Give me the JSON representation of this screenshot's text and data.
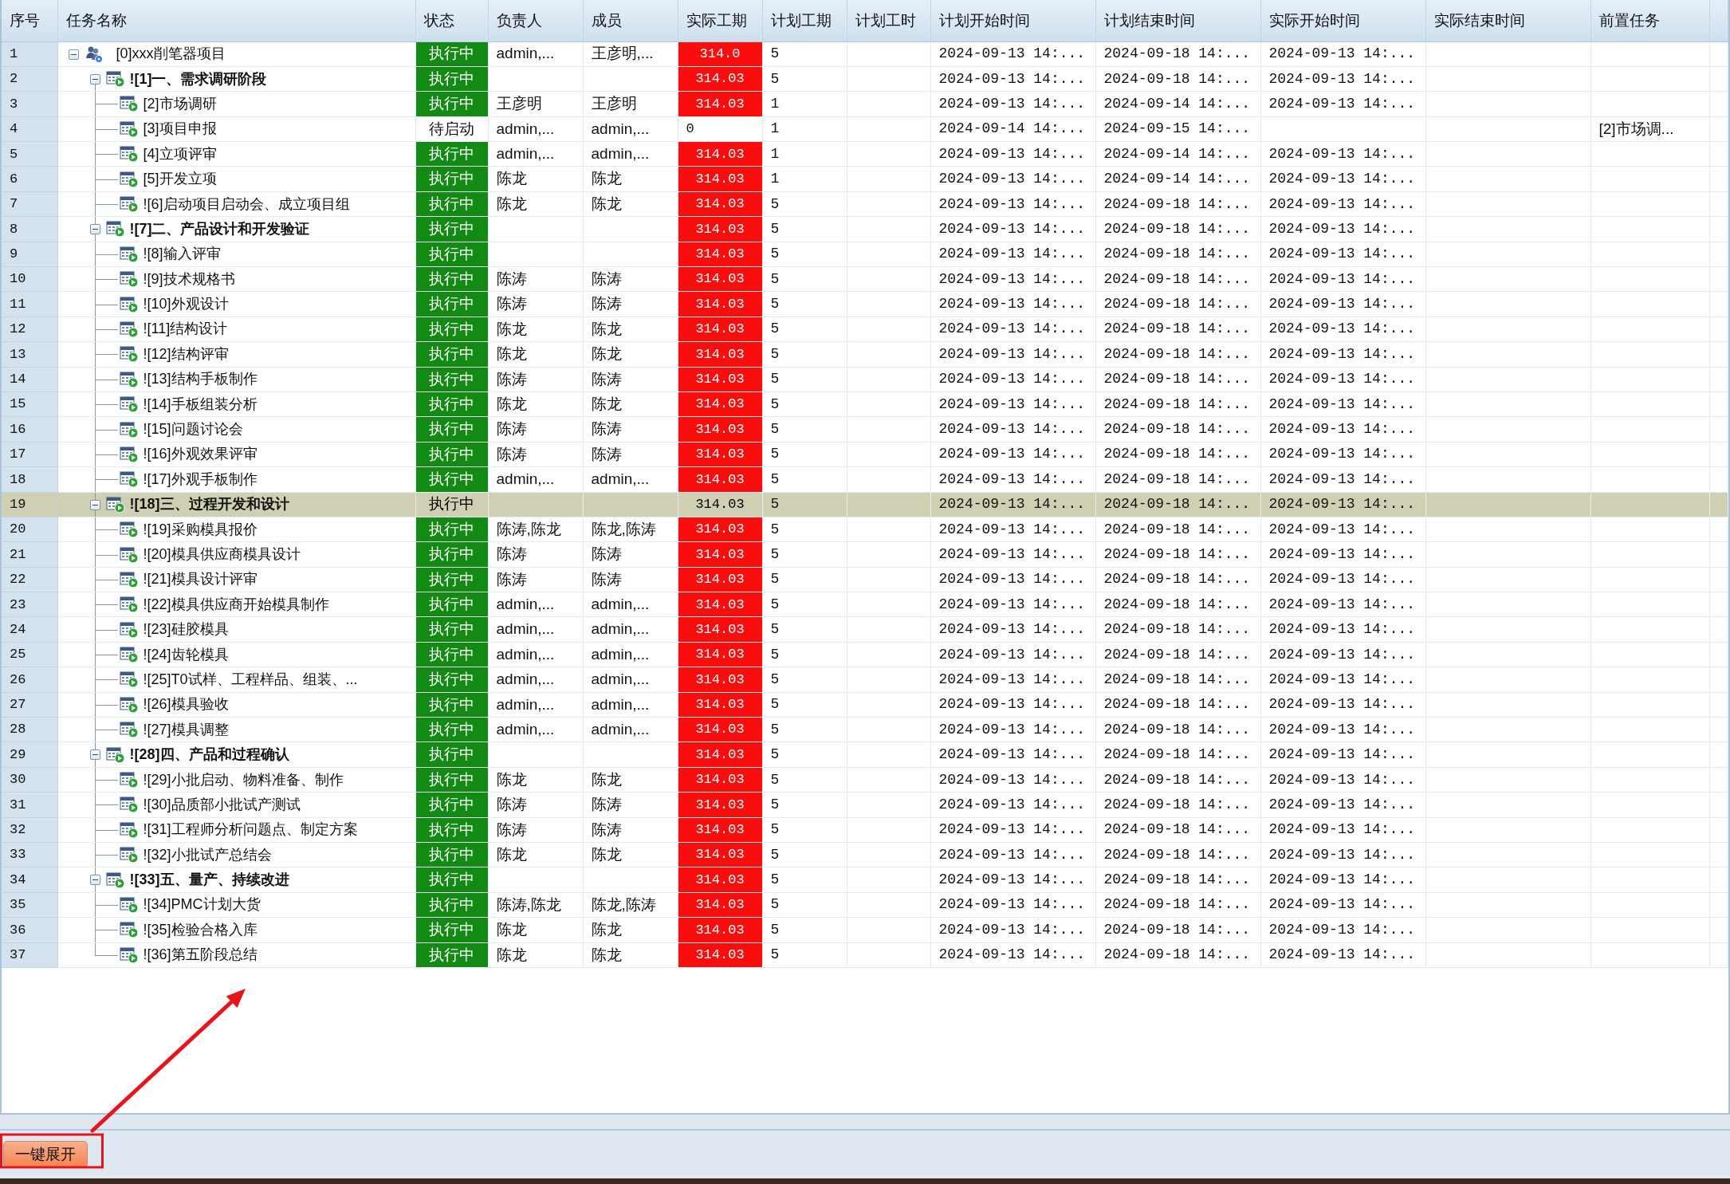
{
  "columns": [
    "序号",
    "任务名称",
    "状态",
    "负责人",
    "成员",
    "实际工期",
    "计划工期",
    "计划工时",
    "计划开始时间",
    "计划结束时间",
    "实际开始时间",
    "实际结束时间",
    "前置任务"
  ],
  "tasks": [
    {
      "seq": "1",
      "name": "[0]xxx削笔器项目",
      "kind": "project",
      "expanded": true,
      "selected": false,
      "status": {
        "text": "执行中",
        "kind": "running"
      },
      "owner": "admin,...",
      "members": "王彦明,...",
      "actual_days": "314.0",
      "overdue": true,
      "plan_days": "5",
      "plan_start": "2024-09-13 14:...",
      "plan_end": "2024-09-18 14:...",
      "actual_start": "2024-09-13 14:...",
      "children": [
        {
          "seq": "2",
          "name": "![1]一、需求调研阶段",
          "kind": "phase",
          "expanded": true,
          "selected": false,
          "status": {
            "text": "执行中",
            "kind": "running"
          },
          "actual_days": "314.03",
          "overdue": true,
          "plan_days": "5",
          "plan_start": "2024-09-13 14:...",
          "plan_end": "2024-09-18 14:...",
          "actual_start": "2024-09-13 14:...",
          "children": [
            {
              "seq": "3",
              "name": "[2]市场调研",
              "kind": "task",
              "selected": false,
              "status": {
                "text": "执行中",
                "kind": "running"
              },
              "owner": "王彦明",
              "members": "王彦明",
              "actual_days": "314.03",
              "overdue": true,
              "plan_days": "1",
              "plan_start": "2024-09-13 14:...",
              "plan_end": "2024-09-14 14:...",
              "actual_start": "2024-09-13 14:..."
            },
            {
              "seq": "4",
              "name": "[3]项目申报",
              "kind": "task",
              "selected": false,
              "status": {
                "text": "待启动",
                "kind": "pending"
              },
              "owner": "admin,...",
              "members": "admin,...",
              "actual_days": "0",
              "overdue": false,
              "plan_days": "1",
              "plan_start": "2024-09-14 14:...",
              "plan_end": "2024-09-15 14:...",
              "predecessor": "[2]市场调..."
            },
            {
              "seq": "5",
              "name": "[4]立项评审",
              "kind": "task",
              "selected": false,
              "status": {
                "text": "执行中",
                "kind": "running"
              },
              "owner": "admin,...",
              "members": "admin,...",
              "actual_days": "314.03",
              "overdue": true,
              "plan_days": "1",
              "plan_start": "2024-09-13 14:...",
              "plan_end": "2024-09-14 14:...",
              "actual_start": "2024-09-13 14:..."
            },
            {
              "seq": "6",
              "name": "[5]开发立项",
              "kind": "task",
              "selected": false,
              "status": {
                "text": "执行中",
                "kind": "running"
              },
              "owner": "陈龙",
              "members": "陈龙",
              "actual_days": "314.03",
              "overdue": true,
              "plan_days": "1",
              "plan_start": "2024-09-13 14:...",
              "plan_end": "2024-09-14 14:...",
              "actual_start": "2024-09-13 14:..."
            },
            {
              "seq": "7",
              "name": "![6]启动项目启动会、成立项目组",
              "kind": "task",
              "selected": false,
              "status": {
                "text": "执行中",
                "kind": "running"
              },
              "owner": "陈龙",
              "members": "陈龙",
              "actual_days": "314.03",
              "overdue": true,
              "plan_days": "5",
              "plan_start": "2024-09-13 14:...",
              "plan_end": "2024-09-18 14:...",
              "actual_start": "2024-09-13 14:..."
            }
          ]
        },
        {
          "seq": "8",
          "name": "![7]二、产品设计和开发验证",
          "kind": "phase",
          "expanded": true,
          "selected": false,
          "status": {
            "text": "执行中",
            "kind": "running"
          },
          "actual_days": "314.03",
          "overdue": true,
          "plan_days": "5",
          "plan_start": "2024-09-13 14:...",
          "plan_end": "2024-09-18 14:...",
          "actual_start": "2024-09-13 14:...",
          "children": [
            {
              "seq": "9",
              "name": "![8]输入评审",
              "kind": "task",
              "selected": false,
              "status": {
                "text": "执行中",
                "kind": "running"
              },
              "actual_days": "314.03",
              "overdue": true,
              "plan_days": "5",
              "plan_start": "2024-09-13 14:...",
              "plan_end": "2024-09-18 14:...",
              "actual_start": "2024-09-13 14:..."
            },
            {
              "seq": "10",
              "name": "![9]技术规格书",
              "kind": "task",
              "selected": false,
              "status": {
                "text": "执行中",
                "kind": "running"
              },
              "owner": "陈涛",
              "members": "陈涛",
              "actual_days": "314.03",
              "overdue": true,
              "plan_days": "5",
              "plan_start": "2024-09-13 14:...",
              "plan_end": "2024-09-18 14:...",
              "actual_start": "2024-09-13 14:..."
            },
            {
              "seq": "11",
              "name": "![10]外观设计",
              "kind": "task",
              "selected": false,
              "status": {
                "text": "执行中",
                "kind": "running"
              },
              "owner": "陈涛",
              "members": "陈涛",
              "actual_days": "314.03",
              "overdue": true,
              "plan_days": "5",
              "plan_start": "2024-09-13 14:...",
              "plan_end": "2024-09-18 14:...",
              "actual_start": "2024-09-13 14:..."
            },
            {
              "seq": "12",
              "name": "![11]结构设计",
              "kind": "task",
              "selected": false,
              "status": {
                "text": "执行中",
                "kind": "running"
              },
              "owner": "陈龙",
              "members": "陈龙",
              "actual_days": "314.03",
              "overdue": true,
              "plan_days": "5",
              "plan_start": "2024-09-13 14:...",
              "plan_end": "2024-09-18 14:...",
              "actual_start": "2024-09-13 14:..."
            },
            {
              "seq": "13",
              "name": "![12]结构评审",
              "kind": "task",
              "selected": false,
              "status": {
                "text": "执行中",
                "kind": "running"
              },
              "owner": "陈龙",
              "members": "陈龙",
              "actual_days": "314.03",
              "overdue": true,
              "plan_days": "5",
              "plan_start": "2024-09-13 14:...",
              "plan_end": "2024-09-18 14:...",
              "actual_start": "2024-09-13 14:..."
            },
            {
              "seq": "14",
              "name": "![13]结构手板制作",
              "kind": "task",
              "selected": false,
              "status": {
                "text": "执行中",
                "kind": "running"
              },
              "owner": "陈涛",
              "members": "陈涛",
              "actual_days": "314.03",
              "overdue": true,
              "plan_days": "5",
              "plan_start": "2024-09-13 14:...",
              "plan_end": "2024-09-18 14:...",
              "actual_start": "2024-09-13 14:..."
            },
            {
              "seq": "15",
              "name": "![14]手板组装分析",
              "kind": "task",
              "selected": false,
              "status": {
                "text": "执行中",
                "kind": "running"
              },
              "owner": "陈龙",
              "members": "陈龙",
              "actual_days": "314.03",
              "overdue": true,
              "plan_days": "5",
              "plan_start": "2024-09-13 14:...",
              "plan_end": "2024-09-18 14:...",
              "actual_start": "2024-09-13 14:..."
            },
            {
              "seq": "16",
              "name": "![15]问题讨论会",
              "kind": "task",
              "selected": false,
              "status": {
                "text": "执行中",
                "kind": "running"
              },
              "owner": "陈涛",
              "members": "陈涛",
              "actual_days": "314.03",
              "overdue": true,
              "plan_days": "5",
              "plan_start": "2024-09-13 14:...",
              "plan_end": "2024-09-18 14:...",
              "actual_start": "2024-09-13 14:..."
            },
            {
              "seq": "17",
              "name": "![16]外观效果评审",
              "kind": "task",
              "selected": false,
              "status": {
                "text": "执行中",
                "kind": "running"
              },
              "owner": "陈涛",
              "members": "陈涛",
              "actual_days": "314.03",
              "overdue": true,
              "plan_days": "5",
              "plan_start": "2024-09-13 14:...",
              "plan_end": "2024-09-18 14:...",
              "actual_start": "2024-09-13 14:..."
            },
            {
              "seq": "18",
              "name": "![17]外观手板制作",
              "kind": "task",
              "selected": false,
              "status": {
                "text": "执行中",
                "kind": "running"
              },
              "owner": "admin,...",
              "members": "admin,...",
              "actual_days": "314.03",
              "overdue": true,
              "plan_days": "5",
              "plan_start": "2024-09-13 14:...",
              "plan_end": "2024-09-18 14:...",
              "actual_start": "2024-09-13 14:..."
            }
          ]
        },
        {
          "seq": "19",
          "name": "![18]三、过程开发和设计",
          "kind": "phase",
          "expanded": true,
          "selected": true,
          "status": {
            "text": "执行中",
            "kind": "running"
          },
          "actual_days": "314.03",
          "overdue": true,
          "plan_days": "5",
          "plan_start": "2024-09-13 14:...",
          "plan_end": "2024-09-18 14:...",
          "actual_start": "2024-09-13 14:...",
          "children": [
            {
              "seq": "20",
              "name": "![19]采购模具报价",
              "kind": "task",
              "selected": false,
              "status": {
                "text": "执行中",
                "kind": "running"
              },
              "owner": "陈涛,陈龙",
              "members": "陈龙,陈涛",
              "actual_days": "314.03",
              "overdue": true,
              "plan_days": "5",
              "plan_start": "2024-09-13 14:...",
              "plan_end": "2024-09-18 14:...",
              "actual_start": "2024-09-13 14:..."
            },
            {
              "seq": "21",
              "name": "![20]模具供应商模具设计",
              "kind": "task",
              "selected": false,
              "status": {
                "text": "执行中",
                "kind": "running"
              },
              "owner": "陈涛",
              "members": "陈涛",
              "actual_days": "314.03",
              "overdue": true,
              "plan_days": "5",
              "plan_start": "2024-09-13 14:...",
              "plan_end": "2024-09-18 14:...",
              "actual_start": "2024-09-13 14:..."
            },
            {
              "seq": "22",
              "name": "![21]模具设计评审",
              "kind": "task",
              "selected": false,
              "status": {
                "text": "执行中",
                "kind": "running"
              },
              "owner": "陈涛",
              "members": "陈涛",
              "actual_days": "314.03",
              "overdue": true,
              "plan_days": "5",
              "plan_start": "2024-09-13 14:...",
              "plan_end": "2024-09-18 14:...",
              "actual_start": "2024-09-13 14:..."
            },
            {
              "seq": "23",
              "name": "![22]模具供应商开始模具制作",
              "kind": "task",
              "selected": false,
              "status": {
                "text": "执行中",
                "kind": "running"
              },
              "owner": "admin,...",
              "members": "admin,...",
              "actual_days": "314.03",
              "overdue": true,
              "plan_days": "5",
              "plan_start": "2024-09-13 14:...",
              "plan_end": "2024-09-18 14:...",
              "actual_start": "2024-09-13 14:..."
            },
            {
              "seq": "24",
              "name": "![23]硅胶模具",
              "kind": "task",
              "selected": false,
              "status": {
                "text": "执行中",
                "kind": "running"
              },
              "owner": "admin,...",
              "members": "admin,...",
              "actual_days": "314.03",
              "overdue": true,
              "plan_days": "5",
              "plan_start": "2024-09-13 14:...",
              "plan_end": "2024-09-18 14:...",
              "actual_start": "2024-09-13 14:..."
            },
            {
              "seq": "25",
              "name": "![24]齿轮模具",
              "kind": "task",
              "selected": false,
              "status": {
                "text": "执行中",
                "kind": "running"
              },
              "owner": "admin,...",
              "members": "admin,...",
              "actual_days": "314.03",
              "overdue": true,
              "plan_days": "5",
              "plan_start": "2024-09-13 14:...",
              "plan_end": "2024-09-18 14:...",
              "actual_start": "2024-09-13 14:..."
            },
            {
              "seq": "26",
              "name": "![25]T0试样、工程样品、组装、...",
              "kind": "task",
              "selected": false,
              "status": {
                "text": "执行中",
                "kind": "running"
              },
              "owner": "admin,...",
              "members": "admin,...",
              "actual_days": "314.03",
              "overdue": true,
              "plan_days": "5",
              "plan_start": "2024-09-13 14:...",
              "plan_end": "2024-09-18 14:...",
              "actual_start": "2024-09-13 14:..."
            },
            {
              "seq": "27",
              "name": "![26]模具验收",
              "kind": "task",
              "selected": false,
              "status": {
                "text": "执行中",
                "kind": "running"
              },
              "owner": "admin,...",
              "members": "admin,...",
              "actual_days": "314.03",
              "overdue": true,
              "plan_days": "5",
              "plan_start": "2024-09-13 14:...",
              "plan_end": "2024-09-18 14:...",
              "actual_start": "2024-09-13 14:..."
            },
            {
              "seq": "28",
              "name": "![27]模具调整",
              "kind": "task",
              "selected": false,
              "status": {
                "text": "执行中",
                "kind": "running"
              },
              "owner": "admin,...",
              "members": "admin,...",
              "actual_days": "314.03",
              "overdue": true,
              "plan_days": "5",
              "plan_start": "2024-09-13 14:...",
              "plan_end": "2024-09-18 14:...",
              "actual_start": "2024-09-13 14:..."
            }
          ]
        },
        {
          "seq": "29",
          "name": "![28]四、产品和过程确认",
          "kind": "phase",
          "expanded": true,
          "selected": false,
          "status": {
            "text": "执行中",
            "kind": "running"
          },
          "actual_days": "314.03",
          "overdue": true,
          "plan_days": "5",
          "plan_start": "2024-09-13 14:...",
          "plan_end": "2024-09-18 14:...",
          "actual_start": "2024-09-13 14:...",
          "children": [
            {
              "seq": "30",
              "name": "![29]小批启动、物料准备、制作",
              "kind": "task",
              "selected": false,
              "status": {
                "text": "执行中",
                "kind": "running"
              },
              "owner": "陈龙",
              "members": "陈龙",
              "actual_days": "314.03",
              "overdue": true,
              "plan_days": "5",
              "plan_start": "2024-09-13 14:...",
              "plan_end": "2024-09-18 14:...",
              "actual_start": "2024-09-13 14:..."
            },
            {
              "seq": "31",
              "name": "![30]品质部小批试产测试",
              "kind": "task",
              "selected": false,
              "status": {
                "text": "执行中",
                "kind": "running"
              },
              "owner": "陈涛",
              "members": "陈涛",
              "actual_days": "314.03",
              "overdue": true,
              "plan_days": "5",
              "plan_start": "2024-09-13 14:...",
              "plan_end": "2024-09-18 14:...",
              "actual_start": "2024-09-13 14:..."
            },
            {
              "seq": "32",
              "name": "![31]工程师分析问题点、制定方案",
              "kind": "task",
              "selected": false,
              "status": {
                "text": "执行中",
                "kind": "running"
              },
              "owner": "陈涛",
              "members": "陈涛",
              "actual_days": "314.03",
              "overdue": true,
              "plan_days": "5",
              "plan_start": "2024-09-13 14:...",
              "plan_end": "2024-09-18 14:...",
              "actual_start": "2024-09-13 14:..."
            },
            {
              "seq": "33",
              "name": "![32]小批试产总结会",
              "kind": "task",
              "selected": false,
              "status": {
                "text": "执行中",
                "kind": "running"
              },
              "owner": "陈龙",
              "members": "陈龙",
              "actual_days": "314.03",
              "overdue": true,
              "plan_days": "5",
              "plan_start": "2024-09-13 14:...",
              "plan_end": "2024-09-18 14:...",
              "actual_start": "2024-09-13 14:..."
            }
          ]
        },
        {
          "seq": "34",
          "name": "![33]五、量产、持续改进",
          "kind": "phase",
          "expanded": true,
          "selected": false,
          "status": {
            "text": "执行中",
            "kind": "running"
          },
          "actual_days": "314.03",
          "overdue": true,
          "plan_days": "5",
          "plan_start": "2024-09-13 14:...",
          "plan_end": "2024-09-18 14:...",
          "actual_start": "2024-09-13 14:...",
          "children": [
            {
              "seq": "35",
              "name": "![34]PMC计划大货",
              "kind": "task",
              "selected": false,
              "status": {
                "text": "执行中",
                "kind": "running"
              },
              "owner": "陈涛,陈龙",
              "members": "陈龙,陈涛",
              "actual_days": "314.03",
              "overdue": true,
              "plan_days": "5",
              "plan_start": "2024-09-13 14:...",
              "plan_end": "2024-09-18 14:...",
              "actual_start": "2024-09-13 14:..."
            },
            {
              "seq": "36",
              "name": "![35]检验合格入库",
              "kind": "task",
              "selected": false,
              "status": {
                "text": "执行中",
                "kind": "running"
              },
              "owner": "陈龙",
              "members": "陈龙",
              "actual_days": "314.03",
              "overdue": true,
              "plan_days": "5",
              "plan_start": "2024-09-13 14:...",
              "plan_end": "2024-09-18 14:...",
              "actual_start": "2024-09-13 14:..."
            },
            {
              "seq": "37",
              "name": "![36]第五阶段总结",
              "kind": "task",
              "selected": false,
              "status": {
                "text": "执行中",
                "kind": "running"
              },
              "owner": "陈龙",
              "members": "陈龙",
              "actual_days": "314.03",
              "overdue": true,
              "plan_days": "5",
              "plan_start": "2024-09-13 14:...",
              "plan_end": "2024-09-18 14:...",
              "actual_start": "2024-09-13 14:..."
            }
          ]
        }
      ]
    }
  ],
  "toolbar": {
    "expand_all_button": "一键展开"
  }
}
